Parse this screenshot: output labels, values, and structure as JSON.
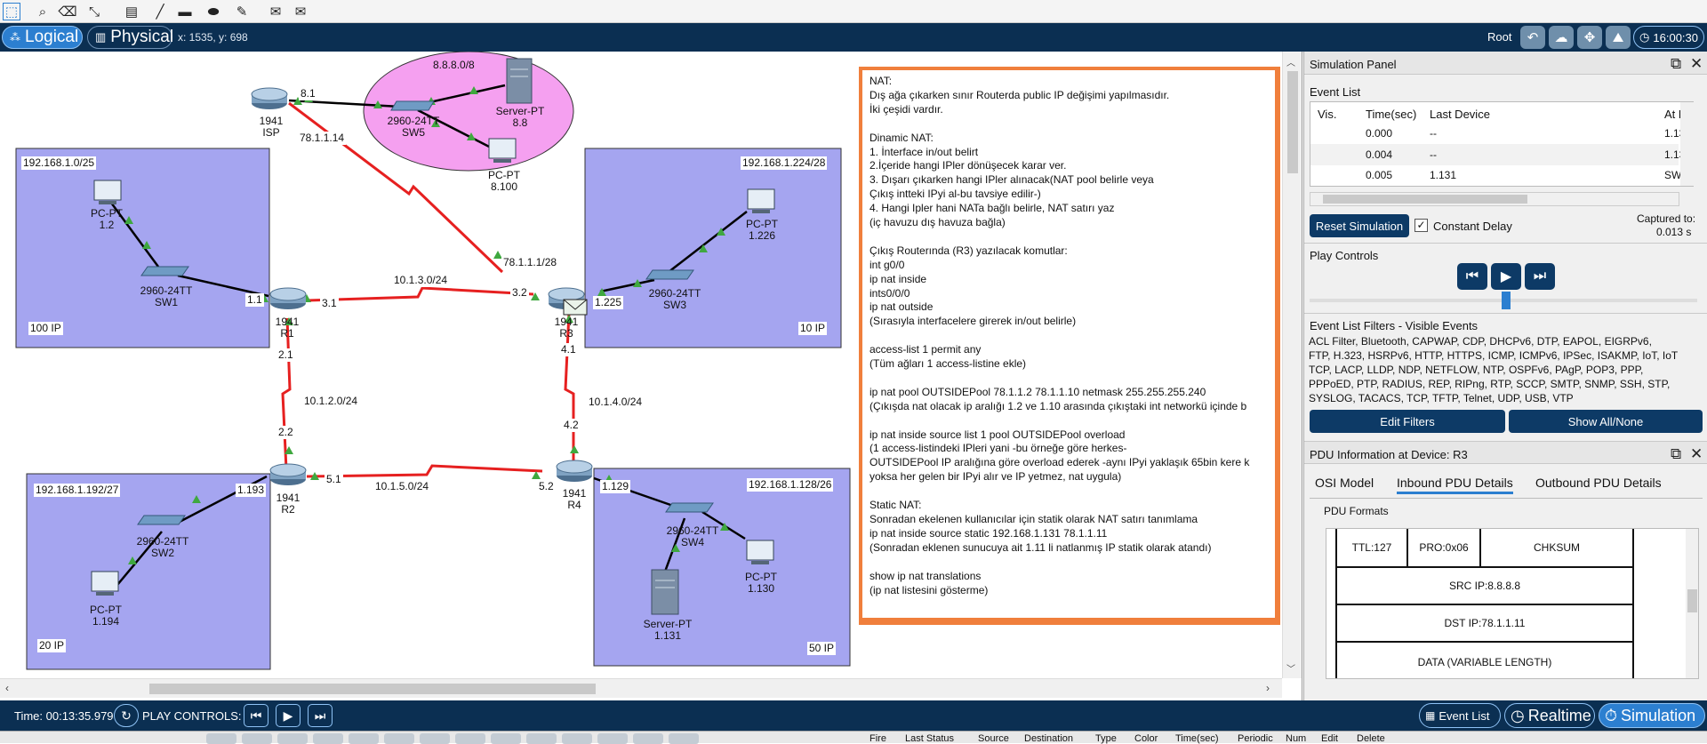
{
  "toolbar": {
    "icons": [
      "select-icon",
      "search-icon",
      "delete-icon",
      "resize-icon",
      "note-icon",
      "line-icon",
      "rectangle-icon",
      "ellipse-icon",
      "freeform-icon",
      "simple-pdu-icon",
      "complex-pdu-icon"
    ]
  },
  "modebar": {
    "logical_label": "Logical",
    "physical_label": "Physical",
    "coords": "x: 1535, y: 698",
    "root_label": "Root",
    "clock": "16:00:30"
  },
  "topology": {
    "zones": [
      {
        "label": "192.168.1.0/25",
        "count": "100 IP"
      },
      {
        "label": "192.168.1.224/28",
        "count": "10 IP"
      },
      {
        "label": "192.168.1.192/27",
        "count": "20 IP"
      },
      {
        "label": "192.168.1.128/26",
        "count": "50 IP"
      }
    ],
    "cloud_label": "8.8.8.0/8",
    "devices": {
      "isp": {
        "model": "1941",
        "name": "ISP"
      },
      "sw5": {
        "model": "2960-24TT",
        "name": "SW5"
      },
      "server88": {
        "model": "Server-PT",
        "name": "8.8"
      },
      "pc8100": {
        "model": "PC-PT",
        "name": "8.100"
      },
      "pc12": {
        "model": "PC-PT",
        "name": "1.2"
      },
      "sw1": {
        "model": "2960-24TT",
        "name": "SW1"
      },
      "r1": {
        "model": "1941",
        "name": "R1"
      },
      "r3": {
        "model": "1941",
        "name": "R3"
      },
      "sw3": {
        "model": "2960-24TT",
        "name": "SW3"
      },
      "pc1226": {
        "model": "PC-PT",
        "name": "1.226"
      },
      "r2": {
        "model": "1941",
        "name": "R2"
      },
      "sw2": {
        "model": "2960-24TT",
        "name": "SW2"
      },
      "pc1194": {
        "model": "PC-PT",
        "name": "1.194"
      },
      "r4": {
        "model": "1941",
        "name": "R4"
      },
      "sw4": {
        "model": "2960-24TT",
        "name": "SW4"
      },
      "pc1130": {
        "model": "PC-PT",
        "name": "1.130"
      },
      "server1131": {
        "model": "Server-PT",
        "name": "1.131"
      }
    },
    "link_labels": {
      "isp_81": "8.1",
      "isp_wan": "78.1.1.14",
      "r3_wan": "78.1.1.1/28",
      "net_13": "10.1.3.0/24",
      "r1_31": "3.1",
      "r3_32": "3.2",
      "r1_11": "1.1",
      "r3_1225": "1.225",
      "r1_21": "2.1",
      "r3_41": "4.1",
      "net_12": "10.1.2.0/24",
      "net_14": "10.1.4.0/24",
      "r2_22": "2.2",
      "r4_42": "4.2",
      "r2_51": "5.1",
      "r4_52": "5.2",
      "net_15": "10.1.5.0/24",
      "r2_1193": "1.193",
      "r4_1129": "1.129"
    }
  },
  "notes": [
    "NAT:",
    "Dış ağa çıkarken sınır Routerda public IP değişimi yapılmasıdır.",
    "İki çeşidi vardır.",
    "",
    "Dinamic NAT:",
    "1. İnterface in/out belirt",
    "2.İçeride hangi IPler dönüşecek karar ver.",
    "3. Dışarı çıkarken hangi IPler alınacak(NAT pool belirle veya",
    "Çıkış intteki IPyi al-bu tavsiye edilir-)",
    "4. Hangi Ipler hani NATa bağlı belirle, NAT satırı yaz",
    "(iç havuzu dış havuza bağla)",
    "",
    "Çıkış Routerında (R3) yazılacak komutlar:",
    "int g0/0",
    "ip nat inside",
    "ints0/0/0",
    "ip nat outside",
    "(Sırasıyla interfacelere girerek in/out belirle)",
    "",
    "access-list 1 permit any",
    "(Tüm ağları 1 access-listine ekle)",
    "",
    "ip nat pool OUTSIDEPool 78.1.1.2 78.1.1.10 netmask 255.255.255.240",
    "(Çıkışda nat olacak ip aralığı 1.2 ve 1.10 arasında çıkıştaki int networkü içinde b",
    "",
    "ip nat inside source list 1 pool OUTSIDEPool overload",
    "(1 access-listindeki IPleri yani -bu örneğe göre herkes-",
    "OUTSIDEPool IP aralığına göre overload ederek -aynı IPyi yaklaşık 65bin kere k",
    "yoksa her gelen bir IPyi alır ve IP yetmez, nat uygula)",
    "",
    "Static NAT:",
    "Sonradan ekelenen kullanıcılar için statik olarak NAT satırı tanımlama",
    "ip nat inside source static 192.168.1.131 78.1.1.11",
    "(Sonradan eklenen sunucuya ait 1.11 li natlanmış IP statik olarak atandı)",
    "",
    "show ip  nat translations",
    "(ip nat listesini gösterme)"
  ],
  "sim_panel": {
    "title": "Simulation Panel",
    "event_list_title": "Event List",
    "columns": [
      "Vis.",
      "Time(sec)",
      "Last Device",
      "At D"
    ],
    "events": [
      {
        "time": "0.000",
        "last": "--",
        "at": "1.13"
      },
      {
        "time": "0.004",
        "last": "--",
        "at": "1.13"
      },
      {
        "time": "0.005",
        "last": "1.131",
        "at": "SW4"
      }
    ],
    "reset_label": "Reset Simulation",
    "constant_delay_label": "Constant Delay",
    "constant_delay_checked": true,
    "captured_label": "Captured to:",
    "captured_value": "0.013 s",
    "play_controls_title": "Play Controls",
    "filters_title": "Event List Filters - Visible Events",
    "filters": [
      "ACL Filter, Bluetooth, CAPWAP, CDP, DHCPv6, DTP, EAPOL, EIGRPv6,",
      "FTP, H.323, HSRPv6, HTTP, HTTPS, ICMP, ICMPv6, IPSec, ISAKMP, IoT, IoT",
      "TCP, LACP, LLDP, NDP, NETFLOW, NTP, OSPFv6, PAgP, POP3, PPP,",
      "PPPoED, PTP, RADIUS, REP, RIPng, RTP, SCCP, SMTP, SNMP, SSH, STP,",
      "SYSLOG, TACACS, TCP, TFTP, Telnet, UDP, USB, VTP"
    ],
    "edit_filters_label": "Edit Filters",
    "show_all_label": "Show All/None"
  },
  "pdu_panel": {
    "title": "PDU Information at Device: R3",
    "tabs": [
      "OSI Model",
      "Inbound PDU Details",
      "Outbound PDU Details"
    ],
    "active_tab": 1,
    "formats_label": "PDU Formats",
    "cells": {
      "ttl": "TTL:127",
      "pro": "PRO:0x06",
      "chksum": "CHKSUM",
      "src": "SRC IP:8.8.8.8",
      "dst": "DST IP:78.1.1.11",
      "data": "DATA (VARIABLE LENGTH)"
    }
  },
  "statusbar": {
    "time": "Time: 00:13:35.979",
    "play_controls": "PLAY CONTROLS:",
    "event_list_label": "Event List",
    "realtime_label": "Realtime",
    "simulation_label": "Simulation"
  },
  "bottom_headers": [
    "Fire",
    "Last Status",
    "Source",
    "Destination",
    "Type",
    "Color",
    "Time(sec)",
    "Periodic",
    "Num",
    "Edit",
    "Delete"
  ],
  "colors": {
    "zone_fill": "#a5a5f0",
    "cloud_fill": "#f5a0f0",
    "serial_link": "#e62020",
    "ethernet_link": "#000000",
    "link_up": "#3fa83f",
    "notes_border": "#f07f3c",
    "dark_blue": "#0b2f52"
  }
}
